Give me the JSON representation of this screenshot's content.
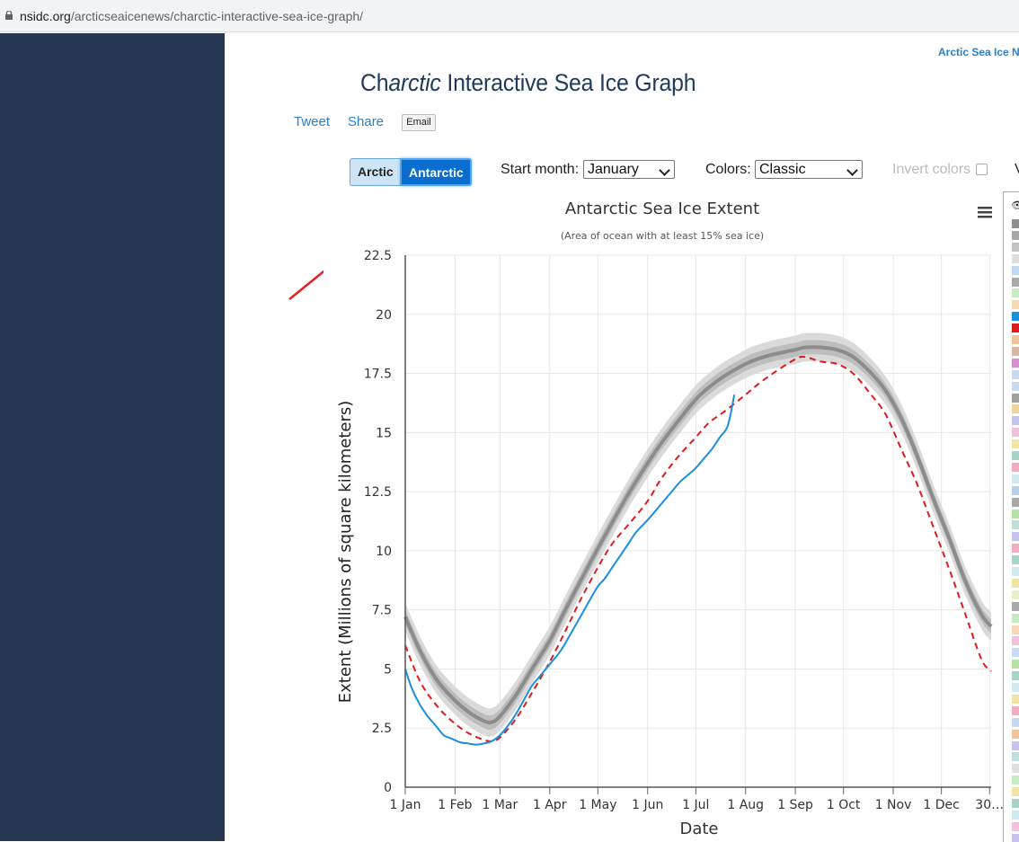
{
  "browser": {
    "url_domain": "nsidc.org",
    "url_path": "/arcticseaicenews/charctic-interactive-sea-ice-graph/"
  },
  "header": {
    "top_link": "Arctic Sea Ice N",
    "title_prefix": "Ch",
    "title_italic": "arctic",
    "title_suffix": " Interactive Sea Ice Graph"
  },
  "share": {
    "tweet": "Tweet",
    "share": "Share",
    "email": "Email"
  },
  "controls": {
    "hemisphere_options": [
      "Arctic",
      "Antarctic"
    ],
    "selected_hemisphere": "Antarctic",
    "start_month_label": "Start month:",
    "start_month_value": "January",
    "colors_label": "Colors:",
    "colors_value": "Classic",
    "invert_colors_label": "Invert colors",
    "invert_colors_checked": false,
    "cut_off_label": "V"
  },
  "colors": {
    "sidebar": "#263852",
    "link": "#2a7fc9",
    "title": "#1f3a5c",
    "selected_button": "#0a6ed1",
    "current_year": "#1a8fe0",
    "record_year": "#e0191b",
    "median": "#8c8c8c",
    "annotation_arrow": "#e8201d"
  },
  "icons": {
    "menu": "hamburger-menu-icon",
    "lock": "lock-icon",
    "legend_toggle": "eye-icon"
  },
  "legend_swatch_colors": [
    "#8f8f8f",
    "#a7a7a7",
    "#c2c2c2",
    "#dedede",
    "#bfd9f2",
    "#a9a9a9",
    "#c7ecc4",
    "#f9d6b4",
    "#1a8fe0",
    "#e0191b",
    "#f2c49b",
    "#d9b7a1",
    "#d98ed4",
    "#c8d9f2",
    "#c9d7ef",
    "#9ea0a0",
    "#f2d39a",
    "#c7c3ee",
    "#f2c2dc",
    "#f2e4a4",
    "#a7d3c8",
    "#f2aec0",
    "#cfeaf0",
    "#b8d0e8",
    "#a9a9a9",
    "#b7e3a6",
    "#bfe0d8",
    "#c7c3ee",
    "#f2aec0",
    "#a7d3c8",
    "#cfeaf0",
    "#f2e4a4",
    "#e7f0c9",
    "#a9a9a9",
    "#c7ecc4",
    "#f9d6b4",
    "#f2c2dc",
    "#c8d9f2",
    "#b7e3a6",
    "#a7d3c8",
    "#cfeaf0",
    "#f2e4a4",
    "#f2aec0",
    "#c9d7ef",
    "#f2c49b",
    "#c7c3ee",
    "#bfe0d8",
    "#e0e0e0",
    "#c7ecc4",
    "#f2e4a4",
    "#a7d3c8",
    "#cfeaf0",
    "#f2c2dc",
    "#c7c3ee",
    "#f2aec0",
    "#b8d0e8",
    "#e7f0c9"
  ],
  "chart_data": {
    "type": "line",
    "title": "Antarctic Sea Ice Extent",
    "subtitle": "(Area of ocean with at least 15% sea ice)",
    "xlabel": "Date",
    "ylabel": "Extent (Millions of square kilometers)",
    "ylim": [
      0,
      22.5
    ],
    "y_ticks": [
      "0",
      "2.5",
      "5",
      "7.5",
      "10",
      "12.5",
      "15",
      "17.5",
      "20",
      "22.5"
    ],
    "x_ticks": [
      "1 Jan",
      "1 Feb",
      "1 Mar",
      "1 Apr",
      "1 May",
      "1 Jun",
      "1 Jul",
      "1 Aug",
      "1 Sep",
      "1 Oct",
      "1 Nov",
      "1 Dec",
      "30…"
    ],
    "x_tick_days": [
      1,
      32,
      60,
      91,
      121,
      152,
      182,
      213,
      244,
      274,
      305,
      335,
      365
    ],
    "xlim": [
      1,
      366
    ],
    "grid": true,
    "legend": "right-panel",
    "series": [
      {
        "style": "median-with-ranges",
        "x": [
          1,
          10,
          20,
          30,
          40,
          50,
          55,
          60,
          70,
          80,
          91,
          100,
          110,
          121,
          130,
          140,
          152,
          160,
          170,
          182,
          190,
          200,
          213,
          220,
          230,
          244,
          250,
          260,
          270,
          280,
          290,
          300,
          310,
          320,
          330,
          340,
          350,
          360,
          366
        ],
        "values": [
          7.2,
          5.8,
          4.6,
          3.8,
          3.2,
          2.8,
          2.75,
          3.0,
          3.9,
          5.0,
          6.2,
          7.4,
          8.7,
          10.1,
          11.2,
          12.4,
          13.7,
          14.5,
          15.4,
          16.4,
          16.9,
          17.4,
          17.9,
          18.1,
          18.3,
          18.5,
          18.6,
          18.6,
          18.5,
          18.2,
          17.6,
          16.8,
          15.6,
          14.0,
          12.2,
          10.5,
          8.7,
          7.3,
          6.8
        ],
        "band_inner_halfwidth": 0.3,
        "band_outer_halfwidth": 0.6
      },
      {
        "style": "record-dashed",
        "x": [
          1,
          10,
          20,
          30,
          40,
          50,
          55,
          60,
          70,
          80,
          91,
          100,
          110,
          121,
          130,
          140,
          152,
          160,
          170,
          182,
          190,
          200,
          213,
          220,
          230,
          244,
          250,
          260,
          270,
          280,
          290,
          300,
          310,
          320,
          330,
          340,
          350,
          360,
          366
        ],
        "values": [
          6.0,
          4.5,
          3.5,
          2.8,
          2.3,
          2.0,
          1.95,
          2.1,
          2.9,
          4.0,
          5.3,
          6.5,
          7.9,
          9.3,
          10.3,
          11.1,
          12.1,
          13.0,
          13.9,
          14.8,
          15.4,
          15.9,
          16.6,
          17.0,
          17.5,
          18.1,
          18.2,
          18.0,
          17.9,
          17.5,
          16.7,
          15.8,
          14.3,
          12.8,
          11.0,
          9.2,
          7.3,
          5.4,
          4.9
        ]
      },
      {
        "style": "current-year",
        "x": [
          1,
          5,
          10,
          15,
          20,
          25,
          30,
          35,
          40,
          45,
          50,
          55,
          60,
          65,
          70,
          75,
          80,
          85,
          91,
          96,
          100,
          105,
          110,
          115,
          121,
          125,
          130,
          135,
          140,
          145,
          152,
          157,
          162,
          167,
          172,
          177,
          182,
          187,
          192,
          197,
          202,
          206
        ],
        "values": [
          5.0,
          4.2,
          3.5,
          3.0,
          2.6,
          2.2,
          2.05,
          1.9,
          1.85,
          1.8,
          1.85,
          1.95,
          2.2,
          2.6,
          3.1,
          3.7,
          4.3,
          4.7,
          5.2,
          5.6,
          6.0,
          6.6,
          7.2,
          7.8,
          8.5,
          8.8,
          9.3,
          9.8,
          10.3,
          10.8,
          11.3,
          11.7,
          12.1,
          12.5,
          12.9,
          13.2,
          13.5,
          13.9,
          14.3,
          14.8,
          15.3,
          16.6
        ]
      }
    ]
  }
}
